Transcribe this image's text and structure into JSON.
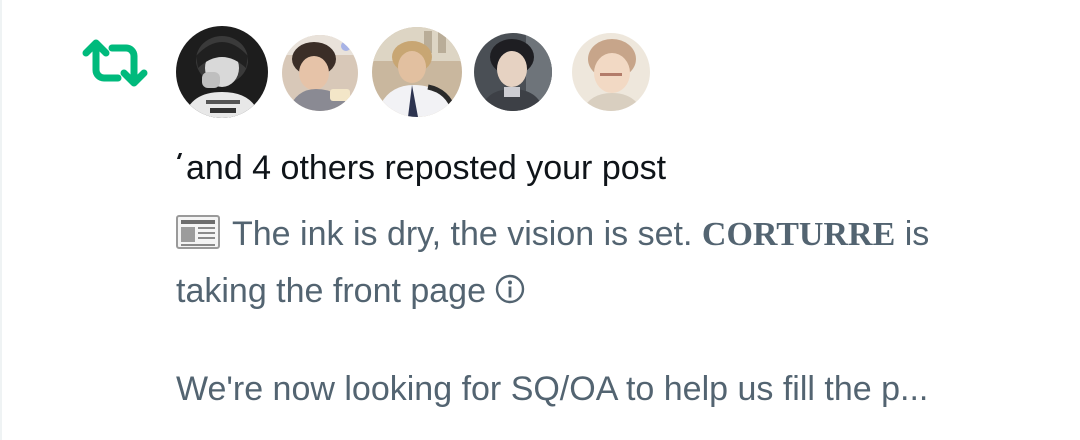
{
  "notification": {
    "type_icon": "repost-icon",
    "accent_color": "#00ba7c",
    "avatars": [
      {
        "icon": "user-avatar-1"
      },
      {
        "icon": "user-avatar-2"
      },
      {
        "icon": "user-avatar-3"
      },
      {
        "icon": "user-avatar-4"
      },
      {
        "icon": "user-avatar-5"
      }
    ],
    "headline": "and 4 others reposted your post",
    "post": {
      "emoji_icon": "newspaper-icon",
      "line1_text": "The ink is dry, the vision is set.",
      "brand": "CORTURRE",
      "line1_suffix": "is",
      "line2_text": "taking the front page",
      "trailing_icon": "info-icon",
      "paragraph2": "We're now looking for SQ/OA to help us fill the p..."
    }
  }
}
